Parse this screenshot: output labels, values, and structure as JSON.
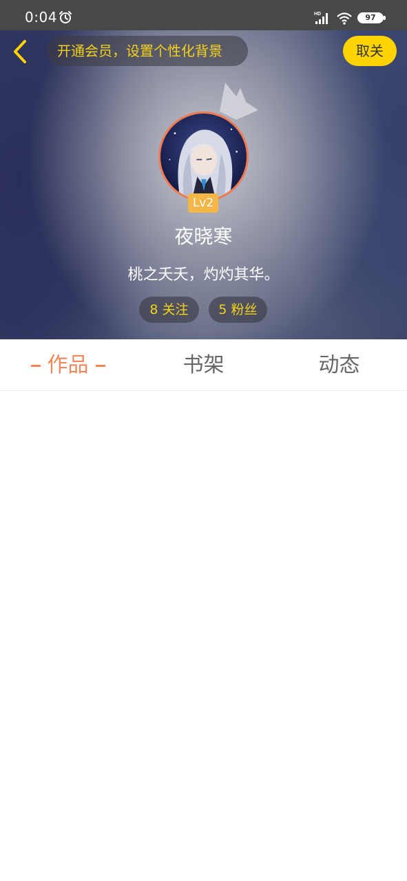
{
  "status_bar": {
    "time": "0:04",
    "battery": "97",
    "network_label": "HD",
    "icons": [
      "alarm-icon",
      "signal-icon",
      "wifi-icon",
      "battery-icon"
    ]
  },
  "header": {
    "vip_banner": "开通会员，设置个性化背景",
    "unfollow_label": "取关",
    "accent_color": "#ffd400"
  },
  "profile": {
    "level": "Lv2",
    "username": "夜晓寒",
    "bio": "桃之夭夭，灼灼其华。",
    "following": "8 关注",
    "followers": "5 粉丝"
  },
  "tabs": [
    {
      "label": "作品",
      "active": true
    },
    {
      "label": "书架",
      "active": false
    },
    {
      "label": "动态",
      "active": false
    }
  ],
  "colors": {
    "active_tab": "#f0875a",
    "avatar_border": "#f37a4f",
    "level_badge": "#f4b646"
  }
}
